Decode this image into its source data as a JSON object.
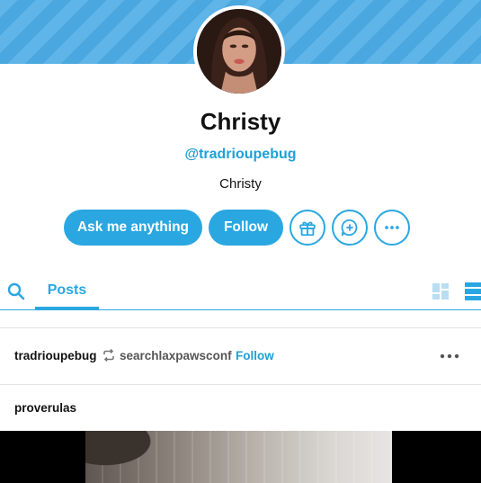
{
  "profile": {
    "name": "Christy",
    "handle": "@tradrioupebug",
    "bio": "Christy"
  },
  "actions": {
    "ask_label": "Ask me anything",
    "follow_label": "Follow"
  },
  "tabs": {
    "posts_label": "Posts"
  },
  "post": {
    "author": "tradrioupebug",
    "reblog_source": "searchlaxpawsconf",
    "follow_label": "Follow",
    "reblogged_from": "proverulas"
  },
  "colors": {
    "accent": "#2aa7e1",
    "banner": "#5fb4e8"
  },
  "icons": [
    "search-icon",
    "gift-icon",
    "message-plus-icon",
    "more-icon",
    "grid-view-icon",
    "list-view-icon",
    "reblog-icon"
  ]
}
